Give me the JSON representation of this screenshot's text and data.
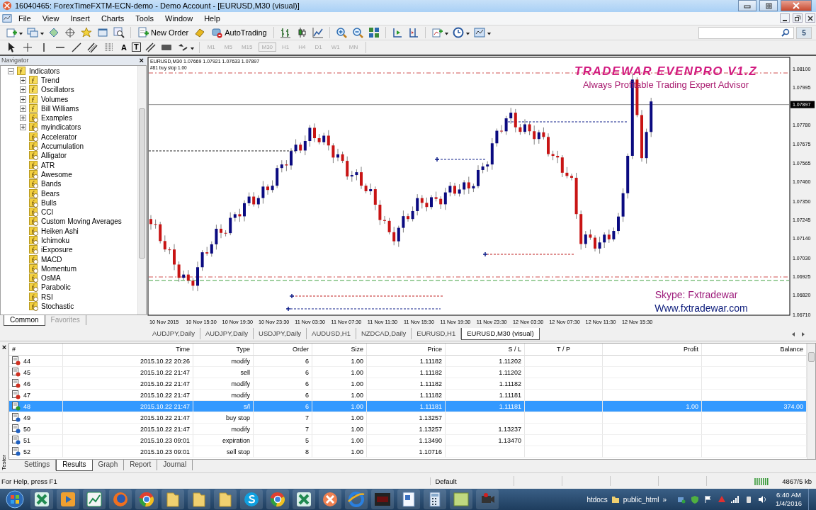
{
  "window": {
    "title": "16040465: ForexTimeFXTM-ECN-demo - Demo Account - [EURUSD,M30 (visual)]"
  },
  "menu": [
    "File",
    "View",
    "Insert",
    "Charts",
    "Tools",
    "Window",
    "Help"
  ],
  "toolbar": {
    "new_order": "New Order",
    "auto_trading": "AutoTrading",
    "text_tool": "A",
    "label_tool": "T",
    "timeframes": [
      {
        "label": "M1",
        "selected": false
      },
      {
        "label": "M5",
        "selected": false
      },
      {
        "label": "M15",
        "selected": false
      },
      {
        "label": "M30",
        "selected": true
      },
      {
        "label": "H1",
        "selected": false
      },
      {
        "label": "H4",
        "selected": false
      },
      {
        "label": "D1",
        "selected": false
      },
      {
        "label": "W1",
        "selected": false
      },
      {
        "label": "MN",
        "selected": false
      }
    ]
  },
  "search": {
    "badge": "5"
  },
  "navigator": {
    "title": "Navigator",
    "close": "×",
    "tree": [
      {
        "label": "Indicators",
        "kind": "folder",
        "expanded": true,
        "children": [
          {
            "label": "Trend",
            "kind": "folder",
            "expanded": false
          },
          {
            "label": "Oscillators",
            "kind": "folder",
            "expanded": false
          },
          {
            "label": "Volumes",
            "kind": "folder",
            "expanded": false
          },
          {
            "label": "Bill Williams",
            "kind": "folder",
            "expanded": false
          },
          {
            "label": "Examples",
            "kind": "custom",
            "expanded": false
          },
          {
            "label": "myindicators",
            "kind": "custom",
            "expanded": false
          },
          {
            "label": "Accelerator",
            "kind": "custom"
          },
          {
            "label": "Accumulation",
            "kind": "custom"
          },
          {
            "label": "Alligator",
            "kind": "custom"
          },
          {
            "label": "ATR",
            "kind": "custom"
          },
          {
            "label": "Awesome",
            "kind": "custom"
          },
          {
            "label": "Bands",
            "kind": "custom"
          },
          {
            "label": "Bears",
            "kind": "custom"
          },
          {
            "label": "Bulls",
            "kind": "custom"
          },
          {
            "label": "CCI",
            "kind": "custom"
          },
          {
            "label": "Custom Moving Averages",
            "kind": "custom"
          },
          {
            "label": "Heiken Ashi",
            "kind": "custom"
          },
          {
            "label": "Ichimoku",
            "kind": "custom"
          },
          {
            "label": "iExposure",
            "kind": "custom"
          },
          {
            "label": "MACD",
            "kind": "custom"
          },
          {
            "label": "Momentum",
            "kind": "custom"
          },
          {
            "label": "OsMA",
            "kind": "custom"
          },
          {
            "label": "Parabolic",
            "kind": "custom"
          },
          {
            "label": "RSI",
            "kind": "custom"
          },
          {
            "label": "Stochastic",
            "kind": "custom"
          }
        ]
      }
    ],
    "tabs": [
      {
        "label": "Common",
        "selected": true
      },
      {
        "label": "Favorites",
        "selected": false
      }
    ]
  },
  "chart": {
    "header": "EURUSD,M30 1.07669 1.07921 1.07633 1.07897",
    "order_label": "#81 buy stop 1.00",
    "banner_title": "TRADEWAR EVENPRO V1.Z",
    "banner_subtitle": "Always Profitable Trading Expert Advisor",
    "contact_skype": "Skype: Fxtradewar",
    "contact_web": "Www.fxtradewar.com",
    "price_ticks": [
      "1.08100",
      "1.07995",
      "1.07780",
      "1.07675",
      "1.07565",
      "1.07460",
      "1.07350",
      "1.07245",
      "1.07140",
      "1.07030",
      "1.06925",
      "1.06820",
      "1.06710"
    ],
    "current_price": "1.07897",
    "time_ticks": [
      "10 Nov 2015",
      "10 Nov 15:30",
      "10 Nov 19:30",
      "10 Nov 23:30",
      "11 Nov 03:30",
      "11 Nov 07:30",
      "11 Nov 11:30",
      "11 Nov 15:30",
      "11 Nov 19:30",
      "11 Nov 23:30",
      "12 Nov 03:30",
      "12 Nov 07:30",
      "12 Nov 11:30",
      "12 Nov 15:30"
    ]
  },
  "chart_tabs": [
    {
      "label": "AUDJPY,Daily",
      "selected": false
    },
    {
      "label": "AUDJPY,Daily",
      "selected": false
    },
    {
      "label": "USDJPY,Daily",
      "selected": false
    },
    {
      "label": "AUDUSD,H1",
      "selected": false
    },
    {
      "label": "NZDCAD,Daily",
      "selected": false
    },
    {
      "label": "EURUSD,H1",
      "selected": false
    },
    {
      "label": "EURUSD,M30 (visual)",
      "selected": true
    }
  ],
  "tester": {
    "label": "Tester",
    "close": "×",
    "columns": [
      "#",
      "Time",
      "Type",
      "Order",
      "Size",
      "Price",
      "S / L",
      "T / P",
      "Profit",
      "Balance"
    ],
    "rows": [
      {
        "num": "44",
        "time": "2015.10.22 20:26",
        "type": "modify",
        "order": "6",
        "size": "1.00",
        "price": "1.11182",
        "sl": "1.11202",
        "color": "#d03020",
        "selected": false
      },
      {
        "num": "45",
        "time": "2015.10.22 21:47",
        "type": "sell",
        "order": "6",
        "size": "1.00",
        "price": "1.11182",
        "sl": "1.11202",
        "color": "#d03020",
        "selected": false
      },
      {
        "num": "46",
        "time": "2015.10.22 21:47",
        "type": "modify",
        "order": "6",
        "size": "1.00",
        "price": "1.11182",
        "sl": "1.11182",
        "color": "#d03020",
        "selected": false
      },
      {
        "num": "47",
        "time": "2015.10.22 21:47",
        "type": "modify",
        "order": "6",
        "size": "1.00",
        "price": "1.11182",
        "sl": "1.11181",
        "color": "#d03020",
        "selected": false
      },
      {
        "num": "48",
        "time": "2015.10.22 21:47",
        "type": "s/l",
        "order": "6",
        "size": "1.00",
        "price": "1.11181",
        "sl": "1.11181",
        "profit": "1.00",
        "balance": "374.00",
        "color": "#2a9a2a",
        "selected": true
      },
      {
        "num": "49",
        "time": "2015.10.22 21:47",
        "type": "buy stop",
        "order": "7",
        "size": "1.00",
        "price": "1.13257",
        "color": "#2060c0",
        "selected": false
      },
      {
        "num": "50",
        "time": "2015.10.22 21:47",
        "type": "modify",
        "order": "7",
        "size": "1.00",
        "price": "1.13257",
        "sl": "1.13237",
        "color": "#2060c0",
        "selected": false
      },
      {
        "num": "51",
        "time": "2015.10.23 09:01",
        "type": "expiration",
        "order": "5",
        "size": "1.00",
        "price": "1.13490",
        "sl": "1.13470",
        "color": "#2060c0",
        "selected": false
      },
      {
        "num": "52",
        "time": "2015.10.23 09:01",
        "type": "sell stop",
        "order": "8",
        "size": "1.00",
        "price": "1.10716",
        "color": "#2060c0",
        "selected": false
      }
    ],
    "tabs": [
      {
        "label": "Settings",
        "selected": false
      },
      {
        "label": "Results",
        "selected": true
      },
      {
        "label": "Graph",
        "selected": false
      },
      {
        "label": "Report",
        "selected": false
      },
      {
        "label": "Journal",
        "selected": false
      }
    ]
  },
  "status_bar": {
    "help": "For Help, press F1",
    "profile": "Default",
    "traffic": "4867/5 kb"
  },
  "taskbar": {
    "toolbar_items": [
      "htdocs",
      "public_html"
    ],
    "overflow": "»",
    "time": "6:40 AM",
    "date": "1/4/2016"
  }
}
